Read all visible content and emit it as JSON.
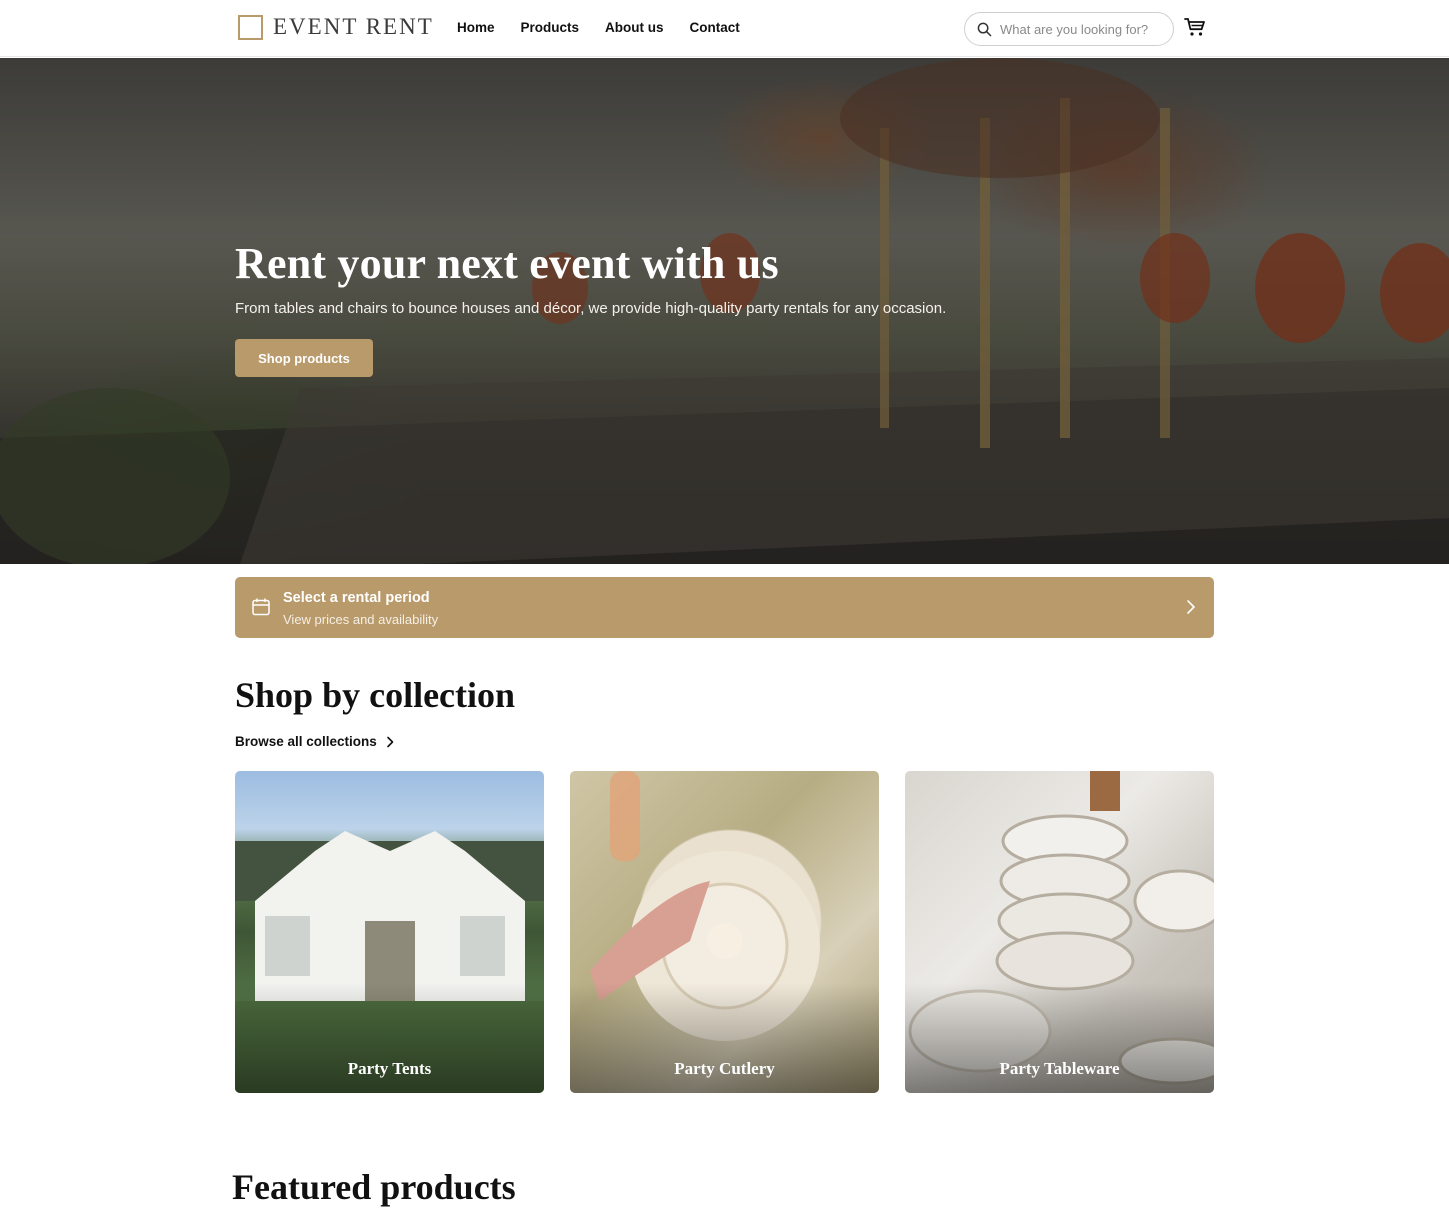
{
  "header": {
    "logo_text": "EVENT RENT",
    "nav": [
      "Home",
      "Products",
      "About us",
      "Contact"
    ],
    "search_placeholder": "What are you looking for?",
    "cart_icon": "cart-icon",
    "search_icon": "search-icon"
  },
  "hero": {
    "title": "Rent your next event with us",
    "subtitle": "From tables and chairs to bounce houses and décor, we provide high-quality party rentals for any occasion.",
    "cta": "Shop products"
  },
  "rental": {
    "title": "Select a rental period",
    "subtitle": "View prices and availability",
    "icon": "calendar-icon"
  },
  "collections": {
    "title": "Shop by collection",
    "browse_label": "Browse all collections",
    "items": [
      {
        "label": "Party Tents"
      },
      {
        "label": "Party Cutlery"
      },
      {
        "label": "Party Tableware"
      }
    ]
  },
  "featured": {
    "title": "Featured products"
  },
  "colors": {
    "accent": "#b99a6b"
  }
}
